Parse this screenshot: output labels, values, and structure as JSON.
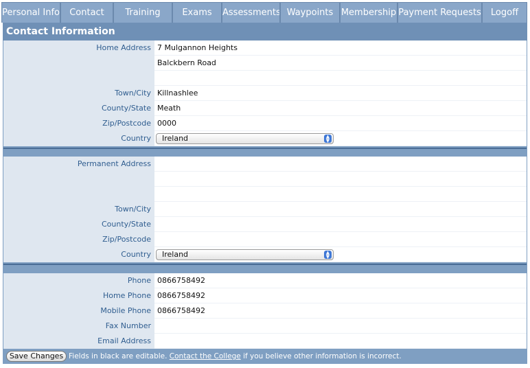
{
  "tabs": [
    {
      "label": "Personal Info"
    },
    {
      "label": "Contact"
    },
    {
      "label": "Training"
    },
    {
      "label": "Exams"
    },
    {
      "label": "Assessments"
    },
    {
      "label": "Waypoints"
    },
    {
      "label": "Membership"
    },
    {
      "label": "Payment Requests"
    },
    {
      "label": "Logoff"
    }
  ],
  "panel": {
    "title": "Contact Information"
  },
  "home": {
    "address_label": "Home Address",
    "address_line1": "7 Mulgannon Heights",
    "address_line2": "Balckbern Road",
    "address_line3": "",
    "town_label": "Town/City",
    "town": "Killnashlee",
    "county_label": "County/State",
    "county": "Meath",
    "zip_label": "Zip/Postcode",
    "zip": "0000",
    "country_label": "Country",
    "country": "Ireland"
  },
  "permanent": {
    "address_label": "Permanent Address",
    "address_line1": "",
    "address_line2": "",
    "address_line3": "",
    "town_label": "Town/City",
    "town": "",
    "county_label": "County/State",
    "county": "",
    "zip_label": "Zip/Postcode",
    "zip": "",
    "country_label": "Country",
    "country": "Ireland"
  },
  "phones": {
    "phone_label": "Phone",
    "phone": "0866758492",
    "home_phone_label": "Home Phone",
    "home_phone": "0866758492",
    "mobile_phone_label": "Mobile Phone",
    "mobile_phone": "0866758492",
    "fax_label": "Fax Number",
    "fax": "",
    "email_label": "Email Address",
    "email": ""
  },
  "footer": {
    "save_label": "Save Changes",
    "text_before": "Fields in black are editable.",
    "link": "Contact the College",
    "text_after": "if you believe other information is incorrect."
  },
  "colors": {
    "tab_bg": "#8aa7c9",
    "header_bg": "#6f90b6",
    "label_bg": "#dfe7f0",
    "label_text": "#2f5d8f"
  }
}
